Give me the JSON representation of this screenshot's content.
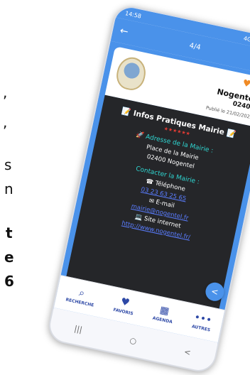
{
  "background_fragments": [
    {
      "text": ",",
      "bold": false
    },
    {
      "text": ",",
      "bold": false
    },
    {
      "text": "s",
      "bold": false
    },
    {
      "text": "n",
      "bold": false
    },
    {
      "text": "t",
      "bold": true
    },
    {
      "text": "e",
      "bold": true
    },
    {
      "text": "6",
      "bold": true
    }
  ],
  "status_bar": {
    "time": "14:58",
    "indicators": "4G ᯤ 56%"
  },
  "app_bar": {
    "back_icon": "←",
    "page_counter": "4/4"
  },
  "card": {
    "town": "Nogentel",
    "zip": "02400",
    "published": "Publié le 21/02/2023",
    "favorite_icon": "♥",
    "alert_icon": "▲"
  },
  "info": {
    "title": "📝 Infos Pratiques Mairie 📝",
    "stars": "★★★★★★",
    "address_heading": "🚀 Adresse de la Mairie :",
    "address_line1": "Place de la Mairie",
    "address_line2": "02400 Nogentel",
    "contact_heading": "Contacter la Mairie :",
    "phone_label": "☎ Téléphone",
    "phone_value": "03 23 63 25 65",
    "email_label": "✉ E-mail",
    "email_value": "mairie@nogentel.fr",
    "website_label": "💻 Site internet",
    "website_value": "http://www.nogentel.fr/"
  },
  "share_icon": "<",
  "bottom_nav": [
    {
      "label": "RECHERCHE",
      "icon": "⌕"
    },
    {
      "label": "FAVORIS",
      "icon": "♥"
    },
    {
      "label": "AGENDA",
      "icon": "▦"
    },
    {
      "label": "AUTRES",
      "icon": "•••"
    }
  ],
  "system_nav": {
    "recent": "|||",
    "home": "○",
    "back": "<"
  },
  "colors": {
    "accent": "#4a92ea",
    "nav_text": "#2d48a6",
    "dark_panel": "#252629",
    "cyan_heading": "#2fd6d1",
    "link": "#5a7dff"
  }
}
